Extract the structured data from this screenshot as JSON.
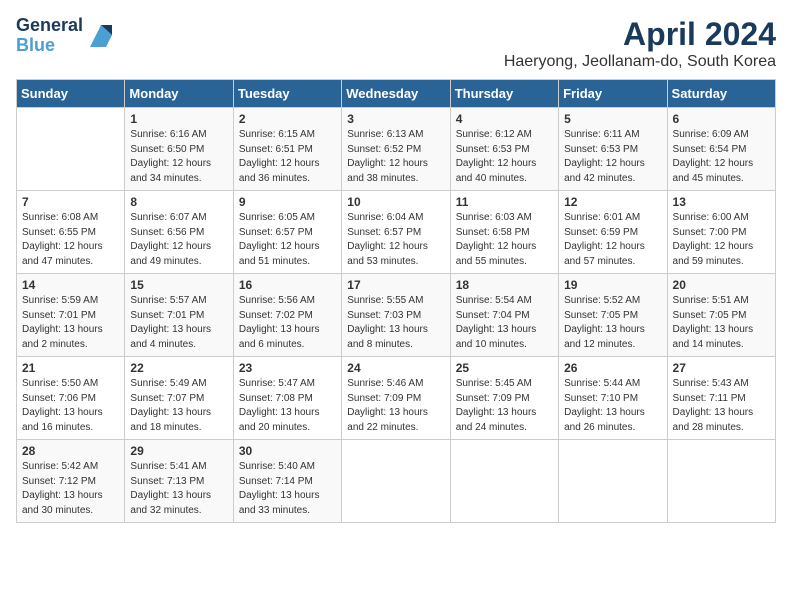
{
  "logo": {
    "line1": "General",
    "line2": "Blue"
  },
  "title": "April 2024",
  "location": "Haeryong, Jeollanam-do, South Korea",
  "days_header": [
    "Sunday",
    "Monday",
    "Tuesday",
    "Wednesday",
    "Thursday",
    "Friday",
    "Saturday"
  ],
  "weeks": [
    [
      {
        "day": "",
        "content": ""
      },
      {
        "day": "1",
        "content": "Sunrise: 6:16 AM\nSunset: 6:50 PM\nDaylight: 12 hours\nand 34 minutes."
      },
      {
        "day": "2",
        "content": "Sunrise: 6:15 AM\nSunset: 6:51 PM\nDaylight: 12 hours\nand 36 minutes."
      },
      {
        "day": "3",
        "content": "Sunrise: 6:13 AM\nSunset: 6:52 PM\nDaylight: 12 hours\nand 38 minutes."
      },
      {
        "day": "4",
        "content": "Sunrise: 6:12 AM\nSunset: 6:53 PM\nDaylight: 12 hours\nand 40 minutes."
      },
      {
        "day": "5",
        "content": "Sunrise: 6:11 AM\nSunset: 6:53 PM\nDaylight: 12 hours\nand 42 minutes."
      },
      {
        "day": "6",
        "content": "Sunrise: 6:09 AM\nSunset: 6:54 PM\nDaylight: 12 hours\nand 45 minutes."
      }
    ],
    [
      {
        "day": "7",
        "content": "Sunrise: 6:08 AM\nSunset: 6:55 PM\nDaylight: 12 hours\nand 47 minutes."
      },
      {
        "day": "8",
        "content": "Sunrise: 6:07 AM\nSunset: 6:56 PM\nDaylight: 12 hours\nand 49 minutes."
      },
      {
        "day": "9",
        "content": "Sunrise: 6:05 AM\nSunset: 6:57 PM\nDaylight: 12 hours\nand 51 minutes."
      },
      {
        "day": "10",
        "content": "Sunrise: 6:04 AM\nSunset: 6:57 PM\nDaylight: 12 hours\nand 53 minutes."
      },
      {
        "day": "11",
        "content": "Sunrise: 6:03 AM\nSunset: 6:58 PM\nDaylight: 12 hours\nand 55 minutes."
      },
      {
        "day": "12",
        "content": "Sunrise: 6:01 AM\nSunset: 6:59 PM\nDaylight: 12 hours\nand 57 minutes."
      },
      {
        "day": "13",
        "content": "Sunrise: 6:00 AM\nSunset: 7:00 PM\nDaylight: 12 hours\nand 59 minutes."
      }
    ],
    [
      {
        "day": "14",
        "content": "Sunrise: 5:59 AM\nSunset: 7:01 PM\nDaylight: 13 hours\nand 2 minutes."
      },
      {
        "day": "15",
        "content": "Sunrise: 5:57 AM\nSunset: 7:01 PM\nDaylight: 13 hours\nand 4 minutes."
      },
      {
        "day": "16",
        "content": "Sunrise: 5:56 AM\nSunset: 7:02 PM\nDaylight: 13 hours\nand 6 minutes."
      },
      {
        "day": "17",
        "content": "Sunrise: 5:55 AM\nSunset: 7:03 PM\nDaylight: 13 hours\nand 8 minutes."
      },
      {
        "day": "18",
        "content": "Sunrise: 5:54 AM\nSunset: 7:04 PM\nDaylight: 13 hours\nand 10 minutes."
      },
      {
        "day": "19",
        "content": "Sunrise: 5:52 AM\nSunset: 7:05 PM\nDaylight: 13 hours\nand 12 minutes."
      },
      {
        "day": "20",
        "content": "Sunrise: 5:51 AM\nSunset: 7:05 PM\nDaylight: 13 hours\nand 14 minutes."
      }
    ],
    [
      {
        "day": "21",
        "content": "Sunrise: 5:50 AM\nSunset: 7:06 PM\nDaylight: 13 hours\nand 16 minutes."
      },
      {
        "day": "22",
        "content": "Sunrise: 5:49 AM\nSunset: 7:07 PM\nDaylight: 13 hours\nand 18 minutes."
      },
      {
        "day": "23",
        "content": "Sunrise: 5:47 AM\nSunset: 7:08 PM\nDaylight: 13 hours\nand 20 minutes."
      },
      {
        "day": "24",
        "content": "Sunrise: 5:46 AM\nSunset: 7:09 PM\nDaylight: 13 hours\nand 22 minutes."
      },
      {
        "day": "25",
        "content": "Sunrise: 5:45 AM\nSunset: 7:09 PM\nDaylight: 13 hours\nand 24 minutes."
      },
      {
        "day": "26",
        "content": "Sunrise: 5:44 AM\nSunset: 7:10 PM\nDaylight: 13 hours\nand 26 minutes."
      },
      {
        "day": "27",
        "content": "Sunrise: 5:43 AM\nSunset: 7:11 PM\nDaylight: 13 hours\nand 28 minutes."
      }
    ],
    [
      {
        "day": "28",
        "content": "Sunrise: 5:42 AM\nSunset: 7:12 PM\nDaylight: 13 hours\nand 30 minutes."
      },
      {
        "day": "29",
        "content": "Sunrise: 5:41 AM\nSunset: 7:13 PM\nDaylight: 13 hours\nand 32 minutes."
      },
      {
        "day": "30",
        "content": "Sunrise: 5:40 AM\nSunset: 7:14 PM\nDaylight: 13 hours\nand 33 minutes."
      },
      {
        "day": "",
        "content": ""
      },
      {
        "day": "",
        "content": ""
      },
      {
        "day": "",
        "content": ""
      },
      {
        "day": "",
        "content": ""
      }
    ]
  ]
}
